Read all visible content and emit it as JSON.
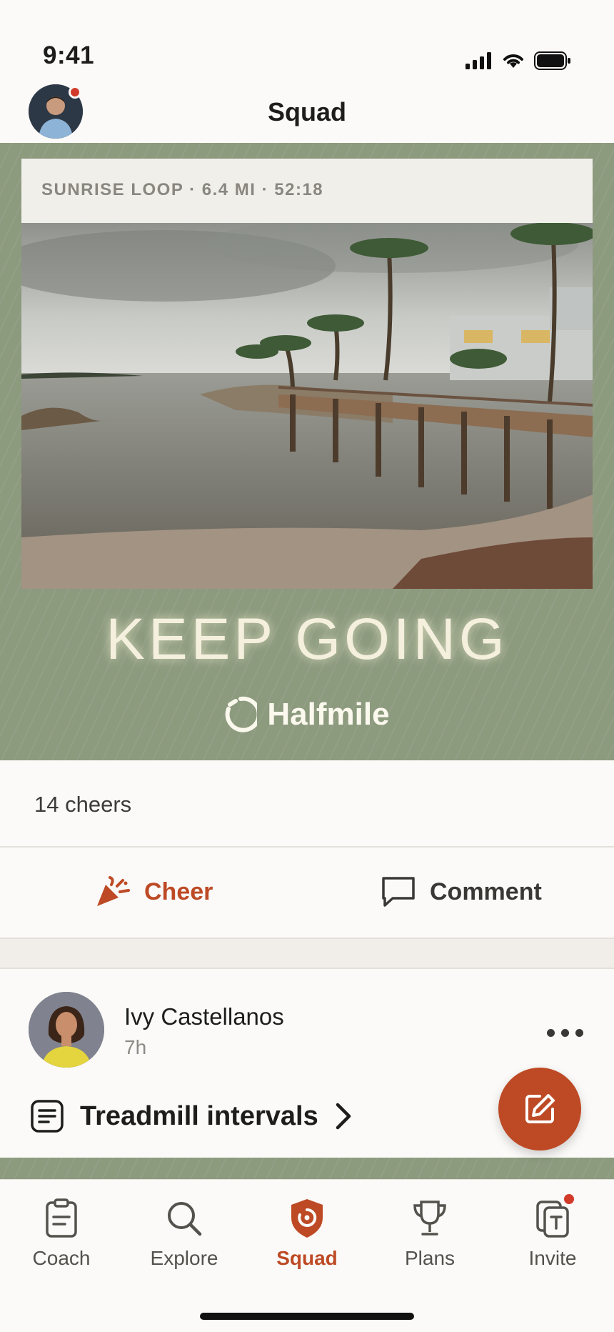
{
  "status_bar": {
    "time": "9:41"
  },
  "header": {
    "title": "Squad"
  },
  "post": {
    "caption": "SUNRISE LOOP · 6.4 MI · 52:18",
    "motto": "KEEP GOING",
    "brand": "Halfmile",
    "cheers_count": "14 cheers",
    "cheer_label": "Cheer",
    "comment_label": "Comment"
  },
  "post2": {
    "name": "Ivy Castellanos",
    "time": "7h",
    "workout_title": "Treadmill intervals"
  },
  "tabs": [
    {
      "label": "Coach",
      "icon": "clipboard-icon"
    },
    {
      "label": "Explore",
      "icon": "search-icon"
    },
    {
      "label": "Squad",
      "icon": "squad-shield-icon",
      "active": true
    },
    {
      "label": "Plans",
      "icon": "trophy-icon"
    },
    {
      "label": "Invite",
      "icon": "invite-icon",
      "badge": true
    }
  ],
  "colors": {
    "accent": "#bd4a25",
    "hero_bg": "#8c9a7e",
    "badge": "#d23b2a"
  }
}
